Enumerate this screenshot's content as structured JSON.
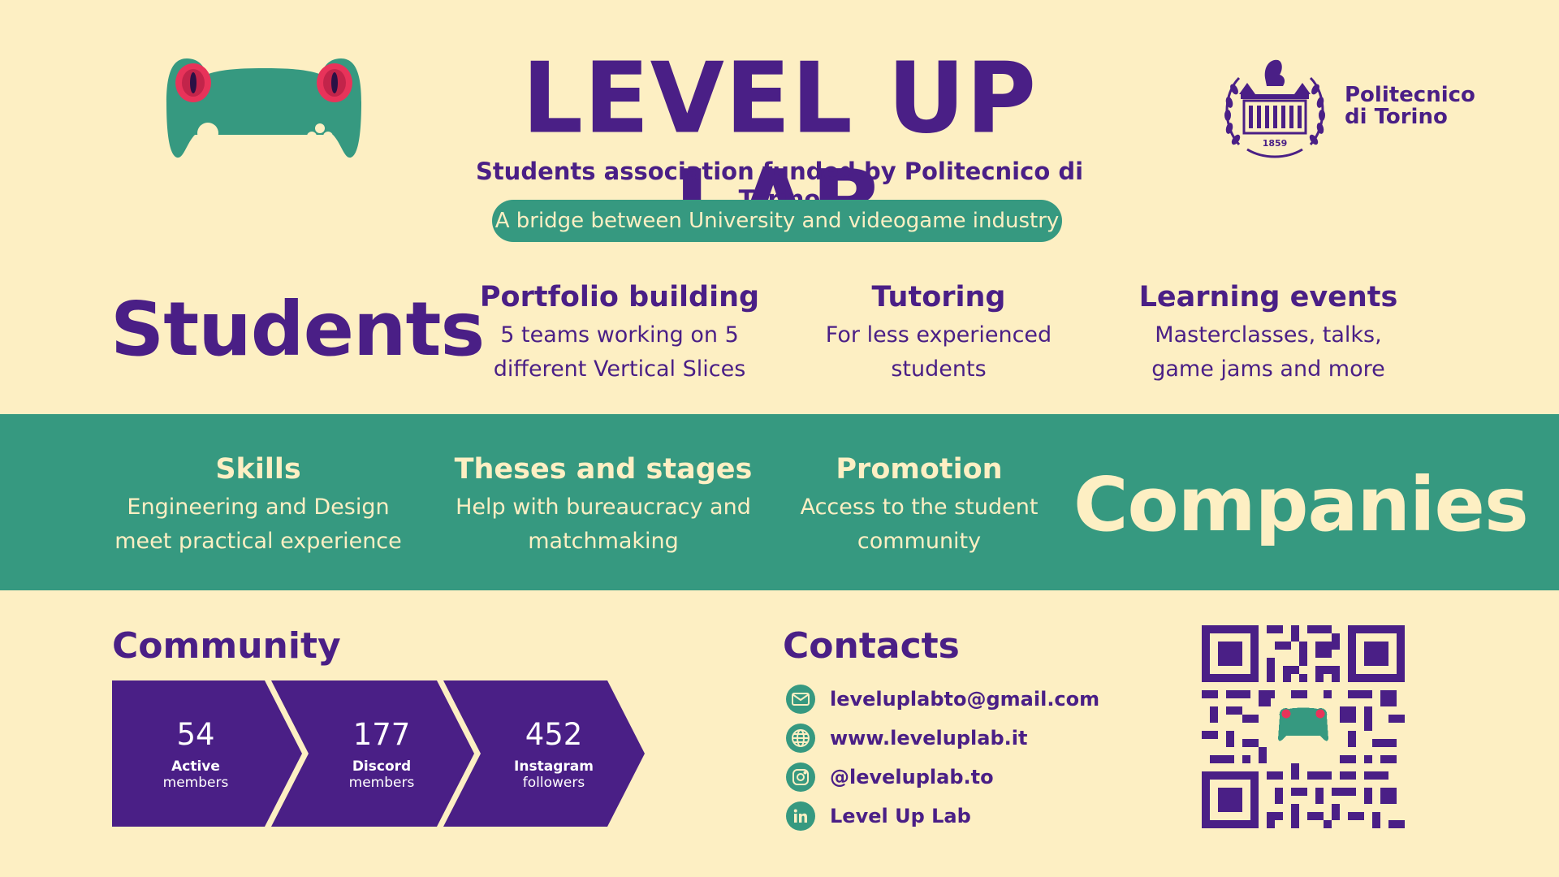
{
  "header": {
    "title": "LEVEL UP LAB",
    "subtitle": "Students association funded by Politecnico di Torino",
    "tagline": "A bridge between University and videogame industry"
  },
  "partner": {
    "name_line1": "Politecnico",
    "name_line2": "di Torino",
    "seal_year": "1859"
  },
  "students": {
    "heading": "Students",
    "features": [
      {
        "title": "Portfolio building",
        "line1": "5 teams working on 5",
        "line2": "different Vertical Slices"
      },
      {
        "title": "Tutoring",
        "line1": "For less experienced",
        "line2": "students"
      },
      {
        "title": "Learning events",
        "line1": "Masterclasses, talks,",
        "line2": "game jams and more"
      }
    ]
  },
  "companies": {
    "heading": "Companies",
    "features": [
      {
        "title": "Skills",
        "line1": "Engineering and Design",
        "line2": "meet practical experience"
      },
      {
        "title": "Theses and stages",
        "line1": "Help with bureaucracy and",
        "line2": "matchmaking"
      },
      {
        "title": "Promotion",
        "line1": "Access to the student",
        "line2": "community"
      }
    ]
  },
  "community": {
    "heading": "Community",
    "stats": [
      {
        "value": "54",
        "label1": "Active",
        "label2": "members"
      },
      {
        "value": "177",
        "label1": "Discord",
        "label2": "members"
      },
      {
        "value": "452",
        "label1": "Instagram",
        "label2": "followers"
      }
    ]
  },
  "contacts": {
    "heading": "Contacts",
    "items": [
      {
        "icon": "email-icon",
        "text": "leveluplabto@gmail.com"
      },
      {
        "icon": "globe-icon",
        "text": "www.leveluplab.it"
      },
      {
        "icon": "instagram-icon",
        "text": "@leveluplab.to"
      },
      {
        "icon": "linkedin-icon",
        "text": "Level Up Lab"
      }
    ]
  },
  "colors": {
    "background": "#fdefc3",
    "purple": "#4a1f86",
    "green": "#369980",
    "red_eye": "#e8335a"
  }
}
